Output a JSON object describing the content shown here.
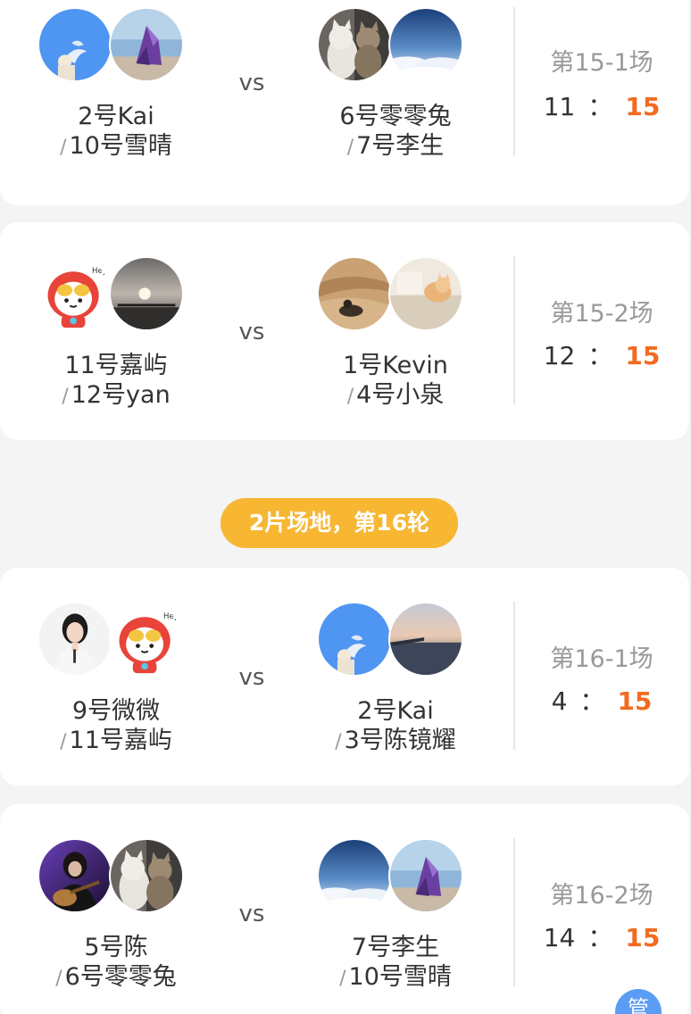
{
  "round_header": "2片场地，第16轮",
  "admin_badge": "管",
  "vs_label": "vs",
  "score_colon": "：",
  "matches": [
    {
      "round": "第15-1场",
      "left": {
        "player1": "2号Kai",
        "player2": "10号雪晴",
        "score": "11",
        "avatars": [
          "avatar-bluebird-icon",
          "avatar-crystal-icon"
        ]
      },
      "right": {
        "player1": "6号零零兔",
        "player2": "7号李生",
        "score": "15",
        "avatars": [
          "avatar-cats-icon",
          "avatar-clouds-icon"
        ]
      },
      "winner": "right"
    },
    {
      "round": "第15-2场",
      "left": {
        "player1": "11号嘉屿",
        "player2": "12号yan",
        "score": "12",
        "avatars": [
          "avatar-cartoon-icon",
          "avatar-sunset-icon"
        ]
      },
      "right": {
        "player1": "1号Kevin",
        "player2": "4号小泉",
        "score": "15",
        "avatars": [
          "avatar-beach-icon",
          "avatar-cat-table-icon"
        ]
      },
      "winner": "right"
    },
    {
      "round": "第16-1场",
      "left": {
        "player1": "9号微微",
        "player2": "11号嘉屿",
        "score": "4",
        "avatars": [
          "avatar-woman-icon",
          "avatar-cartoon-icon"
        ]
      },
      "right": {
        "player1": "2号Kai",
        "player2": "3号陈镜耀",
        "score": "15",
        "avatars": [
          "avatar-bluebird-icon",
          "avatar-pier-icon"
        ]
      },
      "winner": "right"
    },
    {
      "round": "第16-2场",
      "left": {
        "player1": "5号陈",
        "player2": "6号零零兔",
        "score": "14",
        "avatars": [
          "avatar-guitar-icon",
          "avatar-cats-icon"
        ]
      },
      "right": {
        "player1": "7号李生",
        "player2": "10号雪晴",
        "score": "15",
        "avatars": [
          "avatar-clouds-icon",
          "avatar-crystal-icon"
        ]
      },
      "winner": "right"
    }
  ],
  "colors": {
    "accent": "#f26b21",
    "badge": "#f7b733",
    "admin": "#5b9cf5"
  }
}
